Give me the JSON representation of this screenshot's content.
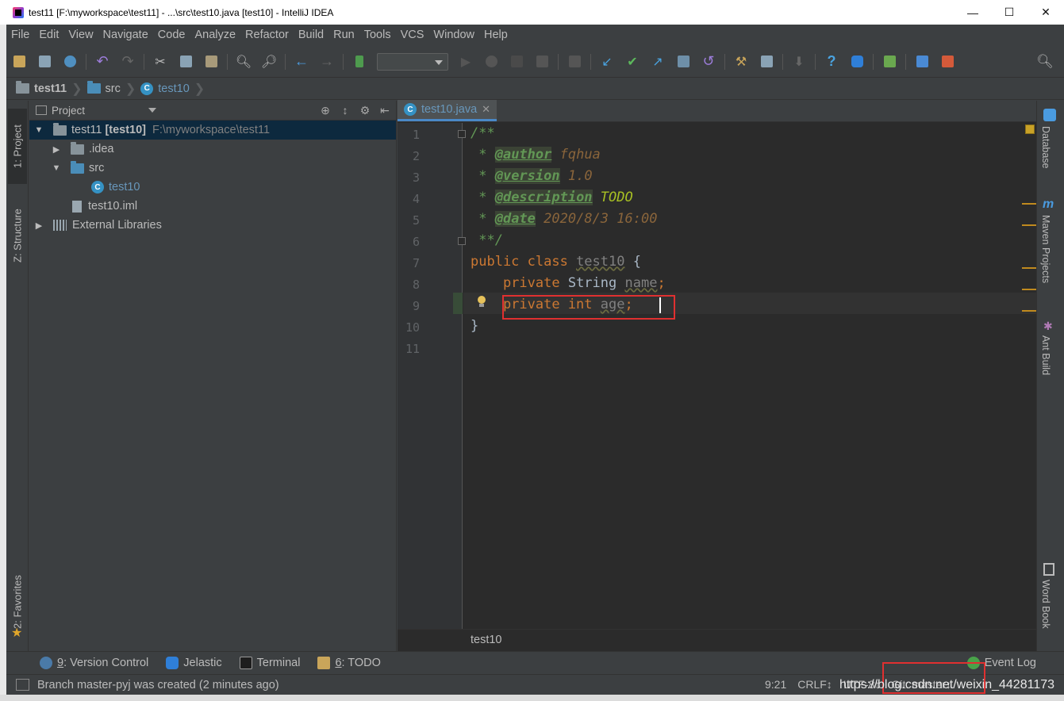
{
  "window": {
    "title": "test11 [F:\\myworkspace\\test11] - ...\\src\\test10.java [test10] - IntelliJ IDEA",
    "minimize": "—",
    "maximize": "☐",
    "close": "✕"
  },
  "menu": [
    "File",
    "Edit",
    "View",
    "Navigate",
    "Code",
    "Analyze",
    "Refactor",
    "Build",
    "Run",
    "Tools",
    "VCS",
    "Window",
    "Help"
  ],
  "breadcrumb": {
    "project": "test11",
    "folder": "src",
    "file": "test10"
  },
  "left_tabs": {
    "project": "1: Project",
    "structure": "Z: Structure",
    "favorites": "2: Favorites"
  },
  "right_tabs": {
    "database": "Database",
    "maven": "Maven Projects",
    "ant": "Ant Build",
    "wordbook": "Word Book"
  },
  "project_panel": {
    "title": "Project",
    "root_name": "test11",
    "root_module": "[test10]",
    "root_path": "F:\\myworkspace\\test11",
    "idea": ".idea",
    "src": "src",
    "class": "test10",
    "iml": "test10.iml",
    "libs": "External Libraries"
  },
  "editor": {
    "tab": "test10.java",
    "footer": "test10",
    "line_numbers": [
      "1",
      "2",
      "3",
      "4",
      "5",
      "6",
      "7",
      "8",
      "9",
      "10",
      "11"
    ],
    "lines": {
      "l1": "/**",
      "l2_star": " * ",
      "l2_tag": "@author",
      "l2_val": " fqhua",
      "l3_star": " * ",
      "l3_tag": "@version",
      "l3_val": " 1.0",
      "l4_star": " * ",
      "l4_tag": "@description",
      "l4_val": " TODO",
      "l5_star": " * ",
      "l5_tag": "@date",
      "l5_val": " 2020/8/3 16:00",
      "l6": " **/",
      "l7_kw": "public class ",
      "l7_name": "test10",
      "l7_rest": " {",
      "l8_kw": "    private ",
      "l8_type": "String ",
      "l8_name": "name",
      "l8_semi": ";",
      "l9_kw": "    private int ",
      "l9_name": "age",
      "l9_semi": ";",
      "l10": "}"
    }
  },
  "bottom_tools": {
    "vc_num": "9",
    "vc": ": Version Control",
    "jelastic": "Jelastic",
    "terminal": "Terminal",
    "todo_num": "6",
    "todo": ": TODO",
    "event_log": "Event Log"
  },
  "status": {
    "message": "Branch master-pyj was created (2 minutes ago)",
    "position": "9:21",
    "line_sep": "CRLF↕",
    "encoding": "UTF-8↕",
    "git": "Git: master↕"
  },
  "watermark": "https://blog.csdn.net/weixin_44281173"
}
